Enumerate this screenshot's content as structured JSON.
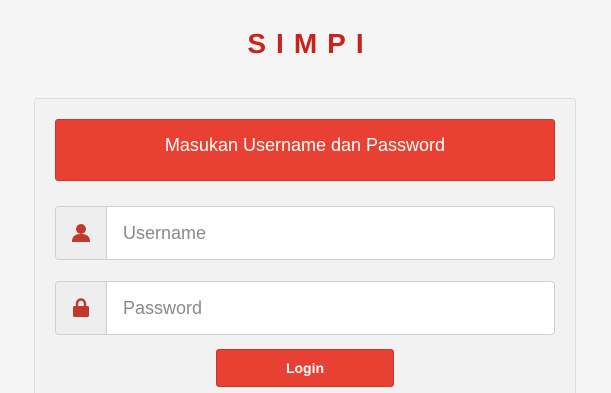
{
  "brand": {
    "title": "SIMPI"
  },
  "login_form": {
    "message": "Masukan Username dan Password",
    "username": {
      "value": "",
      "placeholder": "Username",
      "icon": "user-icon"
    },
    "password": {
      "value": "",
      "placeholder": "Password",
      "icon": "lock-icon"
    },
    "submit_label": "Login"
  },
  "colors": {
    "accent": "#e84133",
    "brand_text": "#c9231d",
    "icon": "#c0392b",
    "background": "#f5f5f5"
  }
}
